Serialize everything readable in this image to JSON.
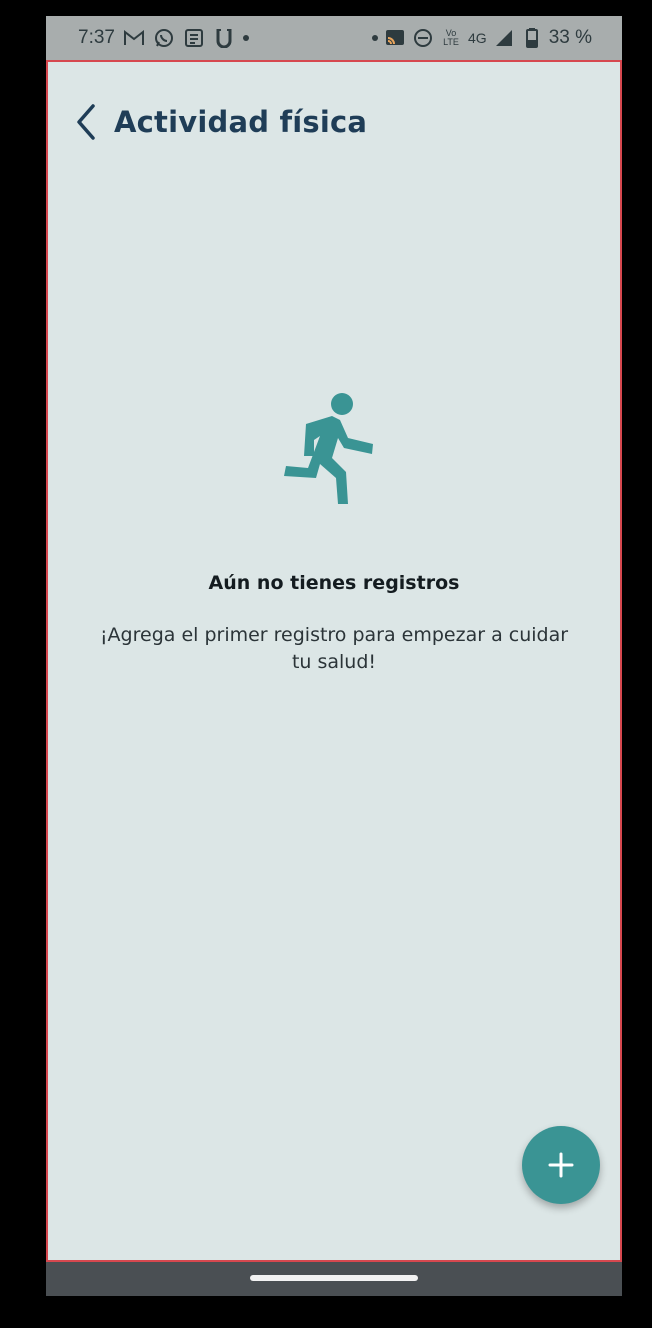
{
  "status_bar": {
    "time": "7:37",
    "left_icons": [
      "gmail-icon",
      "whatsapp-icon",
      "news-icon",
      "uber-icon",
      "dot-icon"
    ],
    "right_icons": [
      "dot-icon",
      "cast-icon",
      "do-not-disturb-icon",
      "volte-icon",
      "signal-icon",
      "battery-icon"
    ],
    "network": "4G",
    "volte": "Vo LTE",
    "battery": "33 %"
  },
  "header": {
    "back_icon": "chevron-left-icon",
    "title": "Actividad física"
  },
  "empty_state": {
    "icon": "running-person-icon",
    "title": "Aún no tienes registros",
    "message": "¡Agrega el primer registro para empezar a cuidar tu salud!"
  },
  "fab": {
    "icon": "plus-icon"
  },
  "colors": {
    "accent": "#3a9494",
    "title": "#1f3d57",
    "background": "#dce6e6",
    "frame_border": "#d6484f"
  }
}
